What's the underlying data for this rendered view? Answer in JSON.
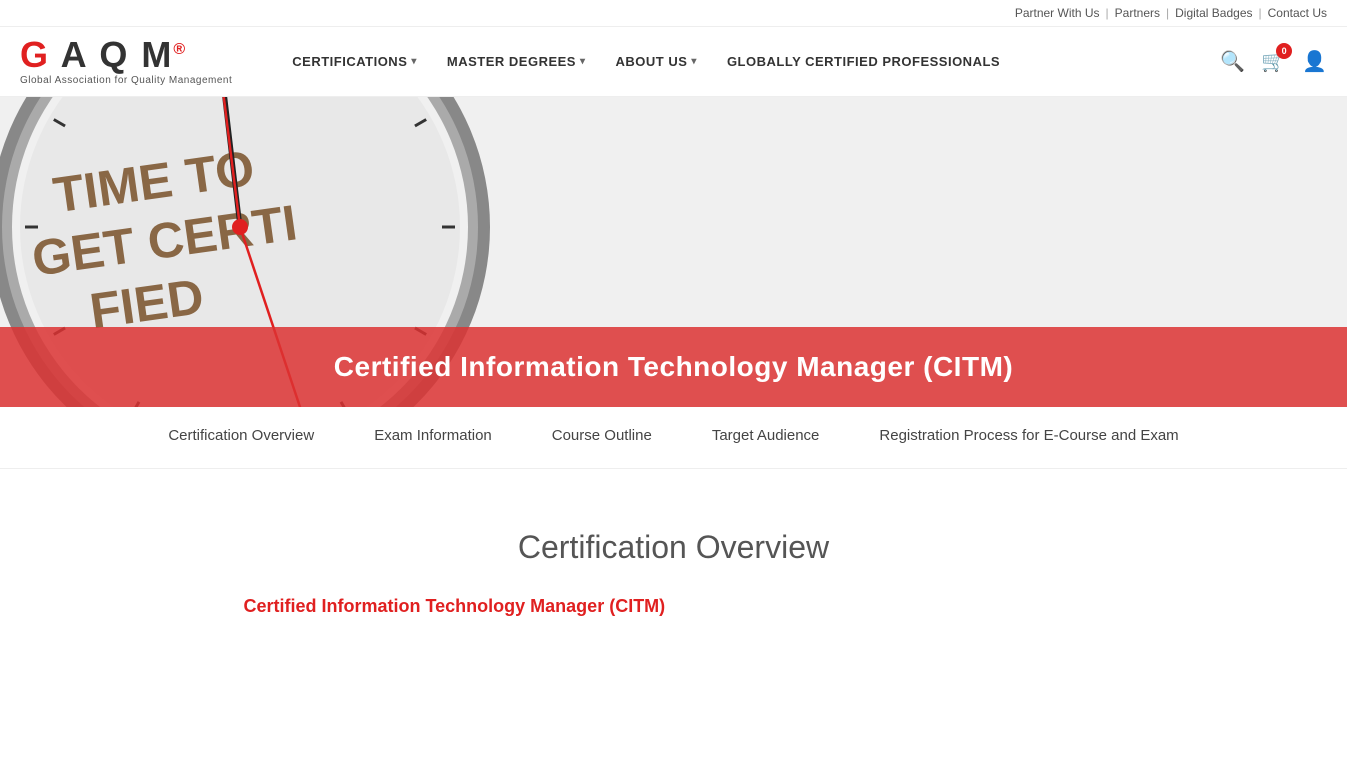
{
  "topbar": {
    "links": [
      {
        "label": "Partner With Us",
        "id": "partner-with-us"
      },
      {
        "label": "Partners",
        "id": "partners"
      },
      {
        "label": "Digital Badges",
        "id": "digital-badges"
      },
      {
        "label": "Contact Us",
        "id": "contact-us"
      }
    ]
  },
  "logo": {
    "text": "GAQM",
    "subtitle": "Global Association for Quality Management",
    "registered_symbol": "®"
  },
  "nav": {
    "items": [
      {
        "label": "CERTIFICATIONS",
        "has_dropdown": true
      },
      {
        "label": "MASTER DEGREES",
        "has_dropdown": true
      },
      {
        "label": "ABOUT US",
        "has_dropdown": true
      },
      {
        "label": "GLOBALLY CERTIFIED PROFESSIONALS",
        "has_dropdown": false
      }
    ]
  },
  "cart": {
    "count": "0"
  },
  "hero": {
    "clock_text_line1": "TIME TO GET",
    "clock_text_line2": "CERTIFIED",
    "title": "Certified Information Technology Manager (CITM)"
  },
  "tabs": [
    {
      "label": "Certification Overview",
      "id": "cert-overview"
    },
    {
      "label": "Exam Information",
      "id": "exam-info"
    },
    {
      "label": "Course Outline",
      "id": "course-outline"
    },
    {
      "label": "Target Audience",
      "id": "target-audience"
    },
    {
      "label": "Registration Process for E-Course and Exam",
      "id": "registration"
    }
  ],
  "content": {
    "section_title": "Certification Overview",
    "section_subtitle": "Certified Information Technology Manager (CITM)"
  }
}
